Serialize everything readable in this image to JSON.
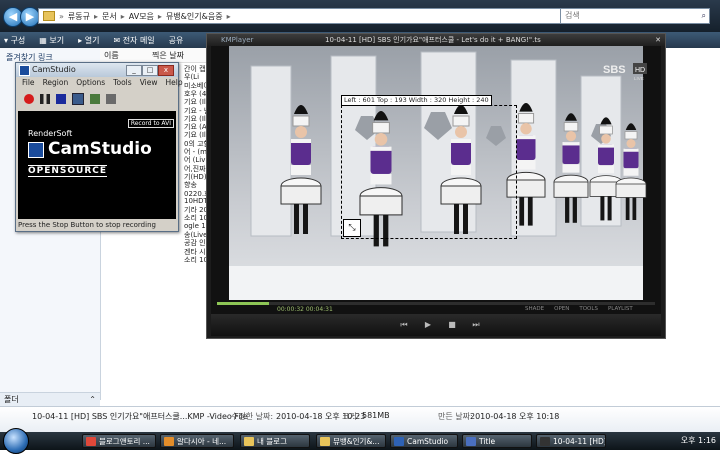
{
  "explorer": {
    "address": [
      "류동규",
      "문서",
      "AV모음",
      "뮤뱅&인기&음중"
    ],
    "search_placeholder": "검색",
    "toolbar": [
      "구성",
      "보기",
      "열기",
      "전자 메일",
      "공유"
    ],
    "nav": {
      "favorites": "즐겨찾기 링크",
      "folders": "폴더"
    },
    "columns": {
      "name": "이름",
      "modified": "찍은 날짜"
    },
    "fragments": [
      "간이 캡",
      "우(Li",
      "미소베이",
      "호우 (4(",
      "기요 (Ill",
      "기요 - 난",
      "기요 (Il",
      "기요 (A",
      "기요 (Il",
      "0의 고함",
      "어 - (m",
      "어 (Liv",
      "어,진짜",
      "기(HD)",
      "향송",
      "0220.효",
      "10HDTV",
      "기라 20",
      "소리 10",
      "ogle 1007",
      "송(Live)",
      "공감 인 (",
      "겐타 시 1",
      "소리 10"
    ],
    "details": {
      "file": "10-04-11 [HD] SBS 인기가요\"애프터스쿨...KMP -Video File",
      "modified_label": "수정한 날짜:",
      "modified": "2010-04-18 오후 10:23",
      "size_label": "크기:",
      "size": "581MB",
      "created_label": "만든 날짜:",
      "created": "2010-04-18 오후 10:18"
    }
  },
  "camstudio": {
    "title": "CamStudio",
    "menu": [
      "File",
      "Region",
      "Options",
      "Tools",
      "View",
      "Help"
    ],
    "record_btn": "Record to AVI",
    "brand_top": "RenderSoft",
    "brand_name": "CamStudio",
    "brand_sub": "OPENSOURCE",
    "status": "Press the Stop Button to stop recording"
  },
  "kmplayer": {
    "app": "KMPlayer",
    "title": "10-04-11 [HD] SBS 인기가요\"애프터스쿨 - Let's do it + BANG!\".ts",
    "logo": "SBS",
    "logo_badge": "HD",
    "logo_live": "LIVE",
    "time": "00:00:32   00:04:31",
    "right_tools": [
      "SHADE",
      "OPEN",
      "TOOLS",
      "PLAYLIST"
    ],
    "progress": 0.118
  },
  "selection": {
    "label": "Left : 601  Top : 193  Width : 320  Height : 240"
  },
  "taskbar": {
    "items": [
      "블로그앤토리 ...",
      "알다시아 - 네...",
      "내 블로그",
      "뮤뱅&인기&...",
      "CamStudio",
      "Title",
      "10-04-11 [HD]..."
    ],
    "clock": "오후 1:16"
  }
}
